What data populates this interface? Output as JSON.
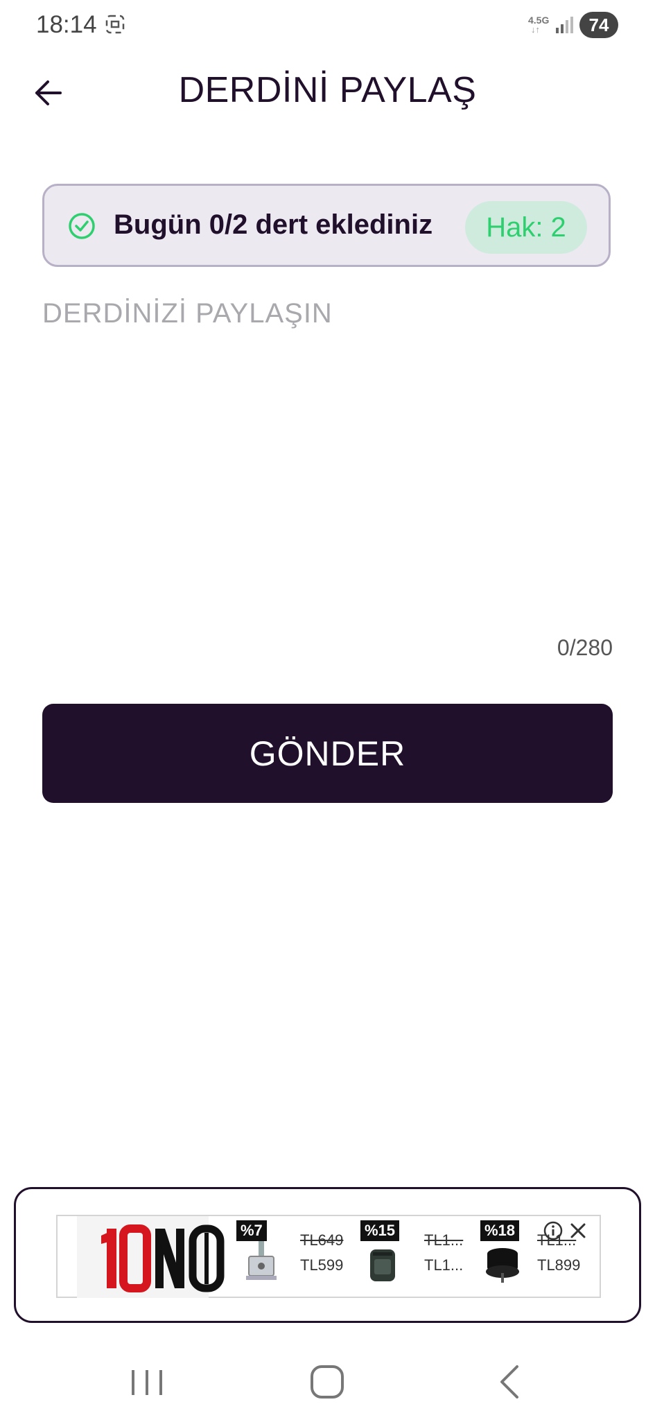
{
  "status_bar": {
    "time": "18:14",
    "network_type": "4.5G",
    "network_arrows": "↓↑",
    "battery": "74",
    "icons": [
      "screenshot-icon",
      "signal-icon"
    ]
  },
  "header": {
    "title": "DERDİNİ PAYLAŞ",
    "back_icon": "back-arrow-icon"
  },
  "quota": {
    "text": "Bugün 0/2 dert eklediniz",
    "badge": "Hak: 2",
    "icon": "check-circle-icon",
    "colors": {
      "check": "#2ecf6f",
      "badge_bg": "#cfebdd",
      "badge_text": "#2ecf6f"
    }
  },
  "composer": {
    "placeholder": "DERDİNİZİ PAYLAŞIN",
    "value": "",
    "counter": "0/280"
  },
  "submit": {
    "label": "GÖNDER",
    "color": "#21102b"
  },
  "ad": {
    "brand": "10NO",
    "products": [
      {
        "discount": "%7",
        "old_price": "TL649",
        "new_price": "TL599"
      },
      {
        "discount": "%15",
        "old_price": "TL1...",
        "new_price": "TL1..."
      },
      {
        "discount": "%18",
        "old_price": "TL1...",
        "new_price": "TL899"
      }
    ],
    "icons": [
      "info-icon",
      "close-icon"
    ]
  },
  "nav_bar": {
    "icons": [
      "recents-icon",
      "home-icon",
      "back-icon"
    ]
  }
}
